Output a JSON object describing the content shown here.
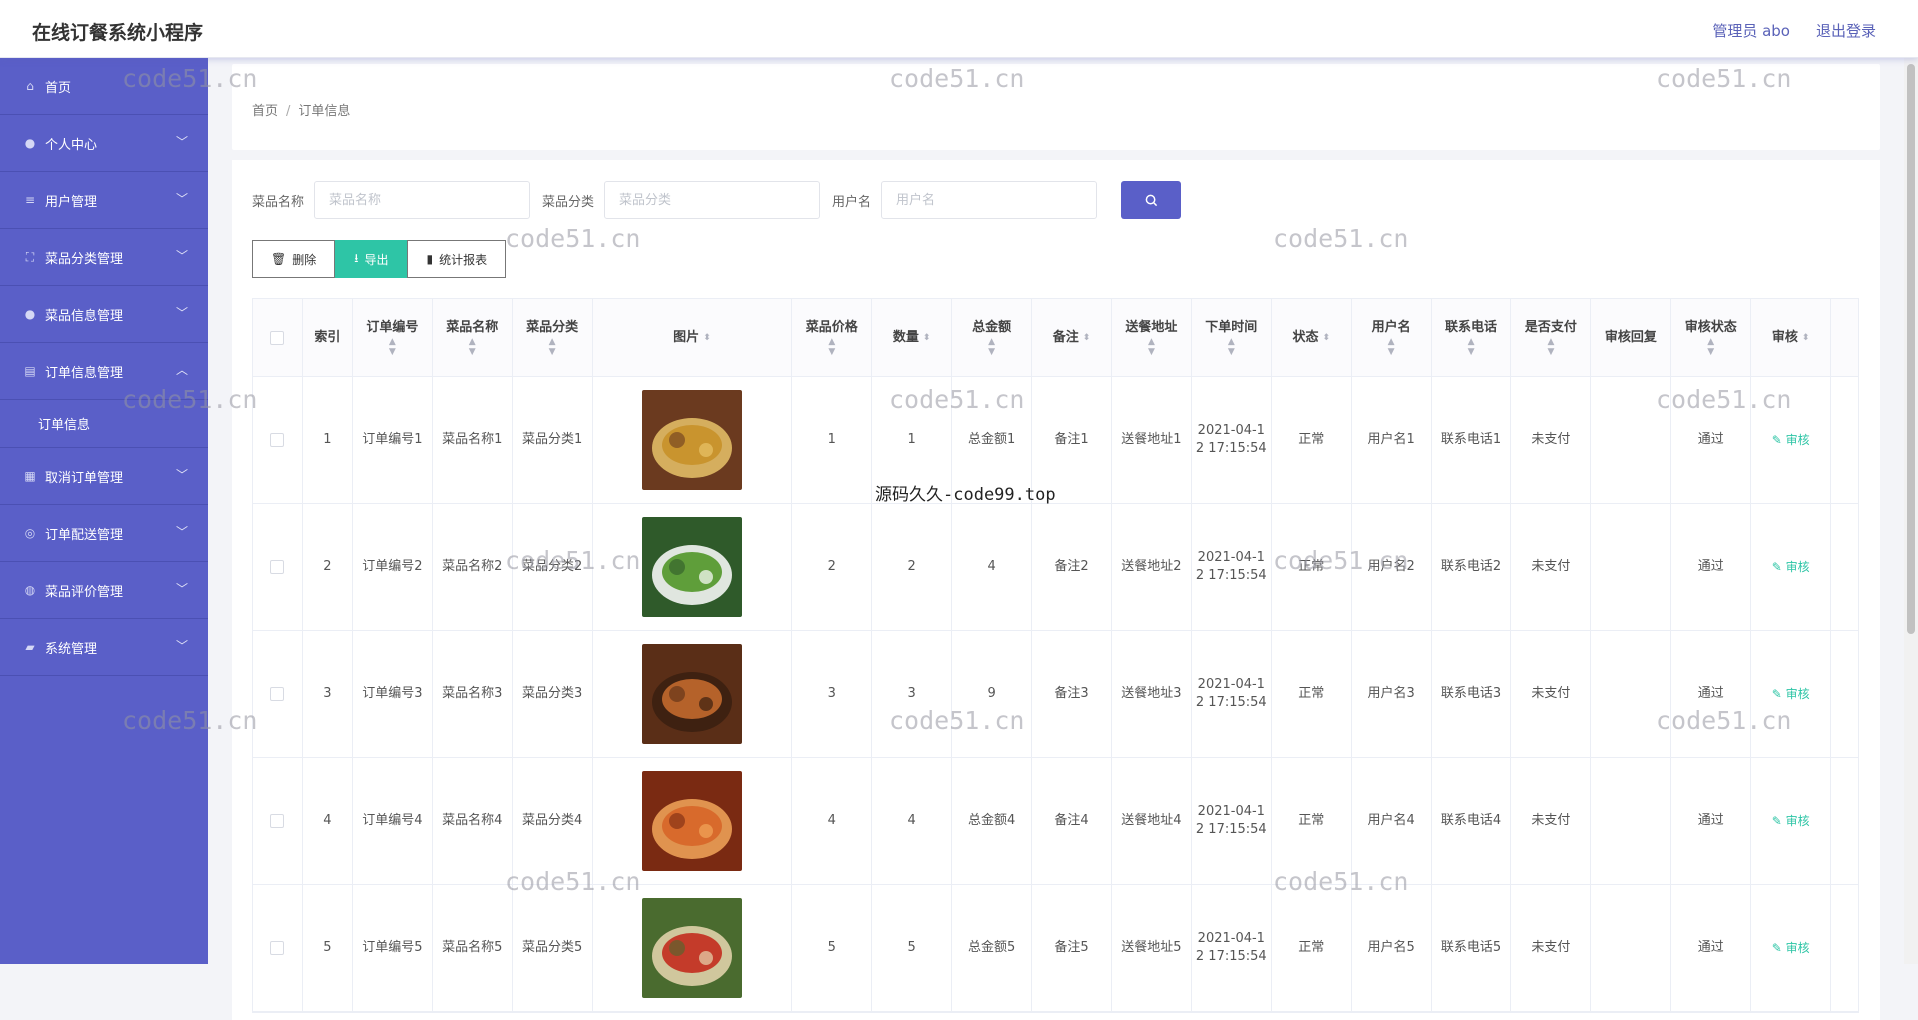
{
  "header": {
    "app_title": "在线订餐系统小程序",
    "user_label": "管理员 abo",
    "logout_label": "退出登录"
  },
  "sidebar": {
    "items": [
      {
        "label": "首页",
        "icon": "home-icon",
        "has_chevron": false
      },
      {
        "label": "个人中心",
        "icon": "user-icon",
        "has_chevron": true
      },
      {
        "label": "用户管理",
        "icon": "list-icon",
        "has_chevron": true
      },
      {
        "label": "菜品分类管理",
        "icon": "category-icon",
        "has_chevron": true
      },
      {
        "label": "菜品信息管理",
        "icon": "bulb-icon",
        "has_chevron": true
      },
      {
        "label": "订单信息管理",
        "icon": "clipboard-icon",
        "has_chevron": true,
        "expanded": true,
        "sub": [
          "订单信息"
        ]
      },
      {
        "label": "取消订单管理",
        "icon": "grid-icon",
        "has_chevron": true
      },
      {
        "label": "订单配送管理",
        "icon": "circle-icon",
        "has_chevron": true
      },
      {
        "label": "菜品评价管理",
        "icon": "compass-icon",
        "has_chevron": true
      },
      {
        "label": "系统管理",
        "icon": "thumb-icon",
        "has_chevron": true
      }
    ]
  },
  "breadcrumb": {
    "home": "首页",
    "sep": "/",
    "current": "订单信息"
  },
  "search": {
    "dish_name_label": "菜品名称",
    "dish_name_placeholder": "菜品名称",
    "category_label": "菜品分类",
    "category_placeholder": "菜品分类",
    "username_label": "用户名",
    "username_placeholder": "用户名"
  },
  "actions": {
    "delete": "删除",
    "export": "导出",
    "report": "统计报表"
  },
  "table": {
    "headers": [
      "索引",
      "订单编号",
      "菜品名称",
      "菜品分类",
      "图片",
      "菜品价格",
      "数量",
      "总金额",
      "备注",
      "送餐地址",
      "下单时间",
      "状态",
      "用户名",
      "联系电话",
      "是否支付",
      "审核回复",
      "审核状态",
      "审核"
    ],
    "rows": [
      {
        "index": "1",
        "order_no": "订单编号1",
        "dish": "菜品名称1",
        "category": "菜品分类1",
        "price": "1",
        "qty": "1",
        "total": "总金额1",
        "note": "备注1",
        "address": "送餐地址1",
        "time": "2021-04-12 17:15:54",
        "state": "正常",
        "user": "用户名1",
        "phone": "联系电话1",
        "paid": "未支付",
        "reply": "",
        "audit_status": "通过",
        "audit_btn": "审核"
      },
      {
        "index": "2",
        "order_no": "订单编号2",
        "dish": "菜品名称2",
        "category": "菜品分类2",
        "price": "2",
        "qty": "2",
        "total": "4",
        "note": "备注2",
        "address": "送餐地址2",
        "time": "2021-04-12 17:15:54",
        "state": "正常",
        "user": "用户名2",
        "phone": "联系电话2",
        "paid": "未支付",
        "reply": "",
        "audit_status": "通过",
        "audit_btn": "审核"
      },
      {
        "index": "3",
        "order_no": "订单编号3",
        "dish": "菜品名称3",
        "category": "菜品分类3",
        "price": "3",
        "qty": "3",
        "total": "9",
        "note": "备注3",
        "address": "送餐地址3",
        "time": "2021-04-12 17:15:54",
        "state": "正常",
        "user": "用户名3",
        "phone": "联系电话3",
        "paid": "未支付",
        "reply": "",
        "audit_status": "通过",
        "audit_btn": "审核"
      },
      {
        "index": "4",
        "order_no": "订单编号4",
        "dish": "菜品名称4",
        "category": "菜品分类4",
        "price": "4",
        "qty": "4",
        "total": "总金额4",
        "note": "备注4",
        "address": "送餐地址4",
        "time": "2021-04-12 17:15:54",
        "state": "正常",
        "user": "用户名4",
        "phone": "联系电话4",
        "paid": "未支付",
        "reply": "",
        "audit_status": "通过",
        "audit_btn": "审核"
      },
      {
        "index": "5",
        "order_no": "订单编号5",
        "dish": "菜品名称5",
        "category": "菜品分类5",
        "price": "5",
        "qty": "5",
        "total": "总金额5",
        "note": "备注5",
        "address": "送餐地址5",
        "time": "2021-04-12 17:15:54",
        "state": "正常",
        "user": "用户名5",
        "phone": "联系电话5",
        "paid": "未支付",
        "reply": "",
        "audit_status": "通过",
        "audit_btn": "审核"
      }
    ]
  },
  "watermarks": {
    "site": "code51.cn",
    "center": "源码久久-code99.top"
  },
  "colors": {
    "sidebar": "#5a5fc8",
    "accent": "#2ec5a6",
    "primary": "#5a5fc8"
  }
}
